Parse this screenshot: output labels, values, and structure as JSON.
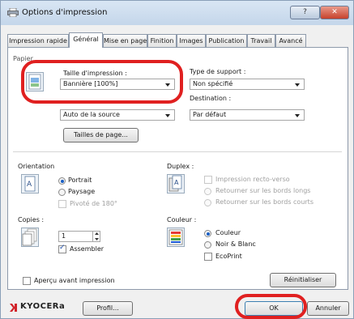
{
  "window": {
    "title": "Options d'impression",
    "help_label": "?",
    "close_label": "✕"
  },
  "tabs": [
    {
      "label": "Impression rapide"
    },
    {
      "label": "Général"
    },
    {
      "label": "Mise en page"
    },
    {
      "label": "Finition"
    },
    {
      "label": "Images"
    },
    {
      "label": "Publication"
    },
    {
      "label": "Travail"
    },
    {
      "label": "Avancé"
    }
  ],
  "paper": {
    "group_label": "Papier",
    "print_size_label": "Taille d'impression :",
    "print_size_value": "Bannière [100%]",
    "source_value": "Auto de la source",
    "page_sizes_button": "Tailles de page...",
    "media_type_label": "Type de support :",
    "media_type_value": "Non spécifié",
    "destination_label": "Destination :",
    "destination_value": "Par défaut"
  },
  "orientation": {
    "label": "Orientation",
    "portrait": "Portrait",
    "landscape": "Paysage",
    "rotate": "Pivoté de 180°",
    "selected": "Portrait"
  },
  "duplex": {
    "label": "Duplex :",
    "print_duplex": "Impression recto-verso",
    "flip_long": "Retourner sur les bords longs",
    "flip_short": "Retourner sur les bords courts"
  },
  "copies": {
    "label": "Copies :",
    "value": "1",
    "collate": "Assembler",
    "collate_checked": true
  },
  "color": {
    "label": "Couleur :",
    "color_option": "Couleur",
    "bw_option": "Noir & Blanc",
    "ecoprint": "EcoPrint",
    "selected": "Couleur"
  },
  "preview": {
    "label": "Aperçu avant impression",
    "checked": false
  },
  "reset_button": "Réinitialiser",
  "footer": {
    "brand": "KYOCERa",
    "profile_button": "Profil...",
    "ok_button": "OK",
    "cancel_button": "Annuler"
  },
  "colors": {
    "accent": "#1a5fc4",
    "highlight": "#e02020",
    "brand": "#d2232a"
  }
}
